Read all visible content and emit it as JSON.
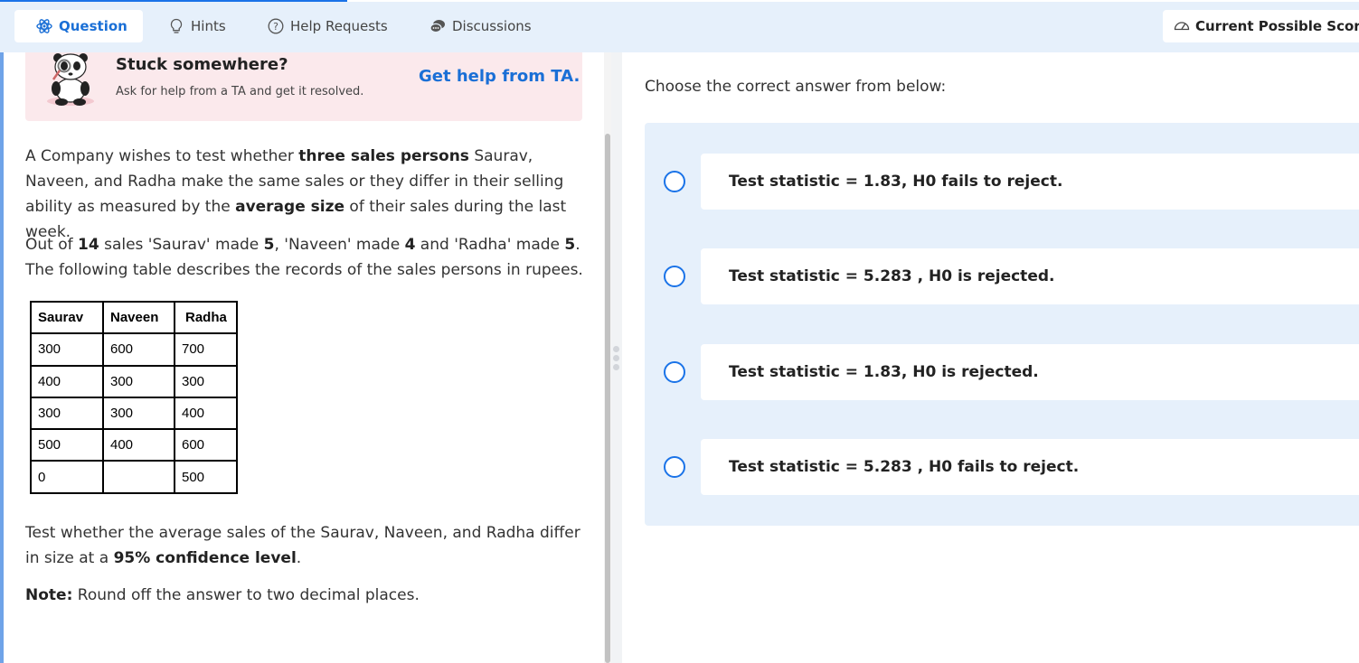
{
  "tabs": [
    {
      "label": "Question",
      "icon": "atom-icon",
      "active": true
    },
    {
      "label": "Hints",
      "icon": "lightbulb-icon",
      "active": false
    },
    {
      "label": "Help Requests",
      "icon": "question-circle-icon",
      "active": false
    },
    {
      "label": "Discussions",
      "icon": "chat-bubbles-icon",
      "active": false
    }
  ],
  "score": {
    "label": "Current Possible Score:",
    "icon": "gauge-icon"
  },
  "help": {
    "title": "Stuck somewhere?",
    "subtitle": "Ask for help from a TA and get it resolved.",
    "link": "Get help from TA.",
    "icon": "panda-magnifier-icon"
  },
  "question": {
    "p1": {
      "t1": "A Company wishes to test whether ",
      "b1": "three sales persons",
      "t2": " Saurav, Naveen, and Radha make the same sales or they differ in their selling ability as measured by the ",
      "b2": "average size",
      "t3": " of their sales during the last week."
    },
    "p2": {
      "t1": "Out of ",
      "b1": "14",
      "t2": " sales 'Saurav' made ",
      "b2": "5",
      "t3": ", 'Naveen' made ",
      "b3": "4",
      "t4": " and 'Radha' made ",
      "b4": "5",
      "t5": ". The following table describes the records of the sales persons in rupees."
    },
    "table": {
      "headers": [
        "Saurav",
        "Naveen",
        "Radha"
      ],
      "rows": [
        [
          "300",
          "600",
          "700"
        ],
        [
          "400",
          "300",
          "300"
        ],
        [
          "300",
          "300",
          "400"
        ],
        [
          "500",
          "400",
          "600"
        ],
        [
          "0",
          "",
          "500"
        ]
      ]
    },
    "p3": {
      "t1": "Test whether the average sales of the Saurav, Naveen, and Radha differ in size at a ",
      "b1": "95% confidence level",
      "t2": "."
    },
    "note": {
      "label": "Note:",
      "text": " Round off the answer to two decimal places."
    }
  },
  "answers": {
    "instruction": "Choose the correct answer from below:",
    "options": [
      "Test statistic = 1.83, H0 fails to reject.",
      "Test statistic = 5.283 , H0 is rejected.",
      "Test statistic = 1.83, H0 is rejected.",
      "Test statistic = 5.283 , H0 fails to reject."
    ]
  },
  "colors": {
    "accent": "#1a73e8",
    "tab_bar": "#e6f0fb",
    "help_card": "#fbe9ec"
  }
}
